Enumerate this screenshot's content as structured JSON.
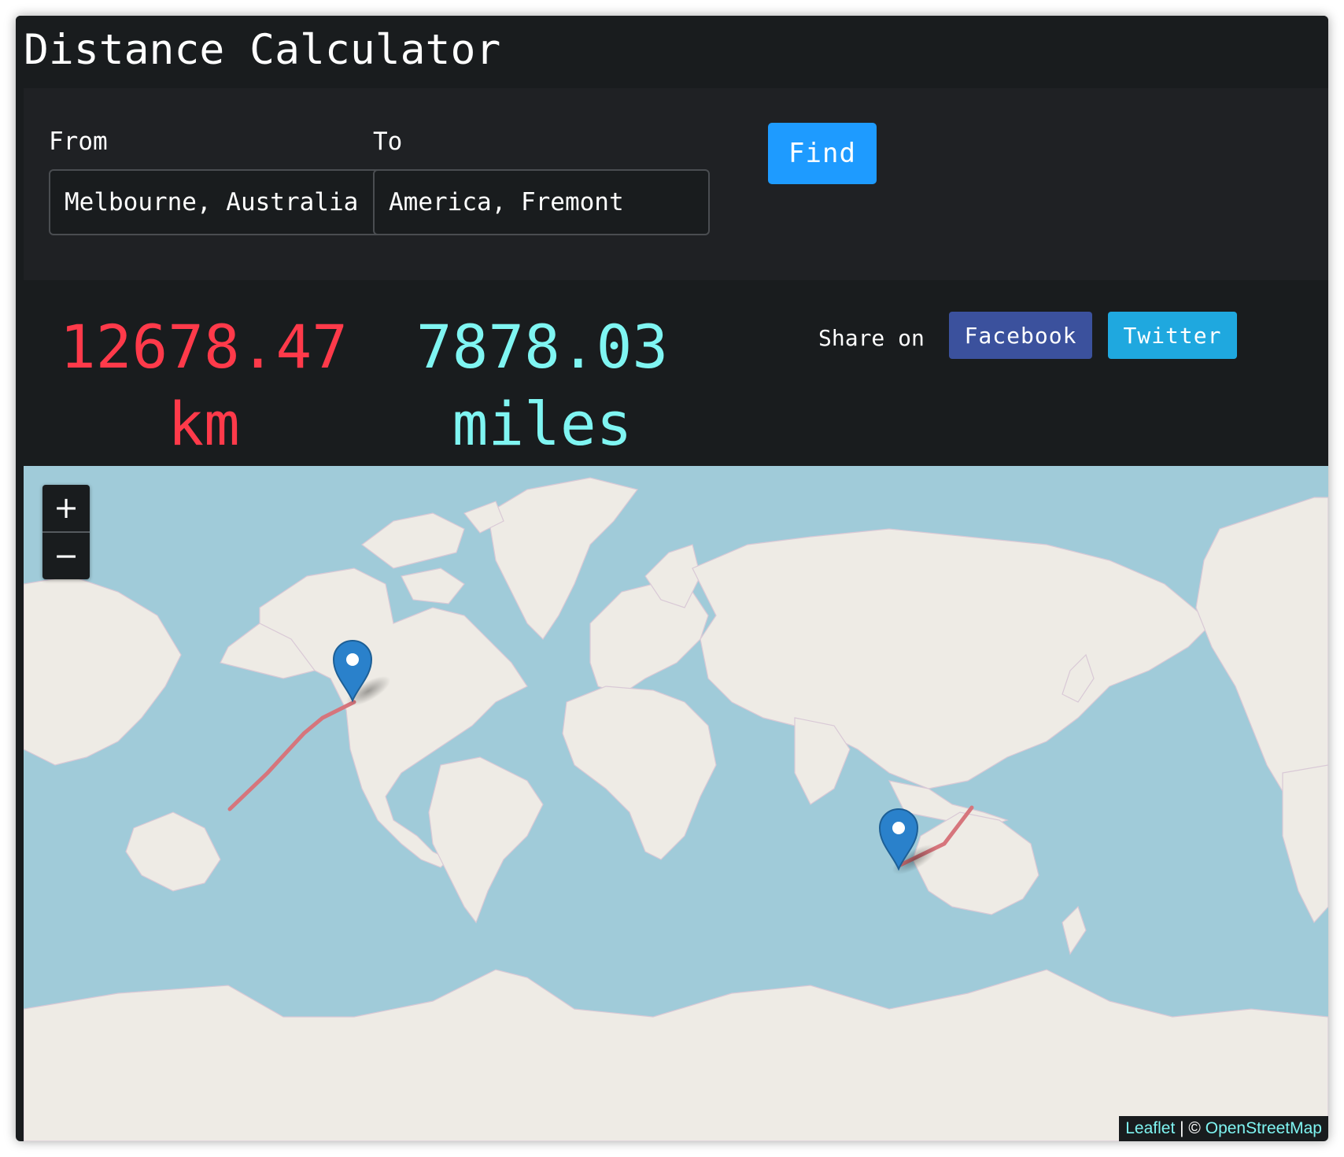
{
  "app": {
    "title": "Distance Calculator"
  },
  "form": {
    "from_label": "From",
    "from_value": "Melbourne, Australia",
    "to_label": "To",
    "to_value": "America, Fremont",
    "find_label": "Find"
  },
  "result": {
    "km_value": "12678.47",
    "km_unit": "km",
    "miles_value": "7878.03",
    "miles_unit": "miles"
  },
  "share": {
    "label": "Share on",
    "facebook_label": "Facebook",
    "twitter_label": "Twitter"
  },
  "map": {
    "zoom_in_label": "+",
    "zoom_out_label": "−",
    "attribution": {
      "leaflet": "Leaflet",
      "separator": " | © ",
      "osm": "OpenStreetMap"
    },
    "markers": [
      {
        "name": "Fremont, USA",
        "icon": "map-pin-icon"
      },
      {
        "name": "Melbourne, Australia",
        "icon": "map-pin-icon"
      }
    ]
  },
  "colors": {
    "background": "#191c1e",
    "km": "#ff3a4a",
    "miles": "#7ff5f2",
    "find": "#1e9bff",
    "facebook": "#3b519d",
    "twitter": "#1fa8df",
    "ocean": "#a0cbd9",
    "land": "#eeebe5",
    "route": "#d6757c",
    "marker": "#2a81cb"
  }
}
